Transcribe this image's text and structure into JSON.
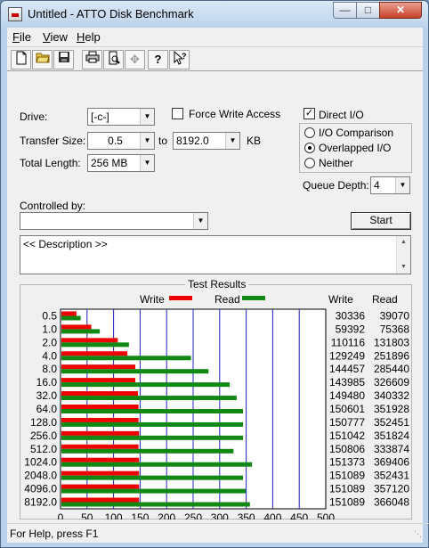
{
  "window": {
    "title": "Untitled - ATTO Disk Benchmark"
  },
  "menu": [
    {
      "key": "F",
      "rest": "ile"
    },
    {
      "key": "V",
      "rest": "iew"
    },
    {
      "key": "H",
      "rest": "elp"
    }
  ],
  "toolbar": {
    "icons": [
      "new-document-icon",
      "open-folder-icon",
      "save-icon",
      "print-icon",
      "print-preview-icon",
      "move-icon",
      "help-question-icon",
      "context-help-icon"
    ]
  },
  "form": {
    "drive_label": "Drive:",
    "drive_value": "[-c-]",
    "force_write_label": "Force Write Access",
    "force_write_checked": false,
    "direct_io_label": "Direct I/O",
    "direct_io_checked": true,
    "transfer_size_label": "Transfer Size:",
    "transfer_from": "0.5",
    "to_label": "to",
    "transfer_to": "8192.0",
    "kb_label": "KB",
    "total_length_label": "Total Length:",
    "total_length_value": "256 MB",
    "io_options": [
      {
        "label": "I/O Comparison",
        "selected": false
      },
      {
        "label": "Overlapped I/O",
        "selected": true
      },
      {
        "label": "Neither",
        "selected": false
      }
    ],
    "queue_depth_label": "Queue Depth:",
    "queue_depth_value": "4",
    "controlled_by_label": "Controlled by:",
    "controlled_by_value": "",
    "start_label": "Start",
    "description": "<< Description >>"
  },
  "results": {
    "title": "Test Results",
    "legend_write": "Write",
    "legend_read": "Read",
    "col_write": "Write",
    "col_read": "Read",
    "xlabel": "Transfer Rate - MB / Sec",
    "write_color": "#ee0000",
    "read_color": "#118811"
  },
  "chart_data": {
    "type": "bar",
    "orientation": "horizontal",
    "categories": [
      "0.5",
      "1.0",
      "2.0",
      "4.0",
      "8.0",
      "16.0",
      "32.0",
      "64.0",
      "128.0",
      "256.0",
      "512.0",
      "1024.0",
      "2048.0",
      "4096.0",
      "8192.0"
    ],
    "series": [
      {
        "name": "Write",
        "values": [
          30336,
          59392,
          110116,
          129249,
          144457,
          143985,
          149480,
          150601,
          150777,
          151042,
          150806,
          151373,
          151089,
          151089,
          151089
        ]
      },
      {
        "name": "Read",
        "values": [
          39070,
          75368,
          131803,
          251896,
          285440,
          326609,
          340332,
          351928,
          352451,
          351824,
          333874,
          369406,
          352431,
          357120,
          366048
        ]
      }
    ],
    "bar_values_mb_s": {
      "write": [
        30,
        58,
        108,
        126,
        141,
        141,
        146,
        147,
        147,
        148,
        147,
        148,
        148,
        148,
        148
      ],
      "read": [
        38,
        74,
        129,
        246,
        279,
        319,
        332,
        344,
        344,
        344,
        326,
        361,
        344,
        349,
        357
      ]
    },
    "xticks": [
      "0",
      "50",
      "100",
      "150",
      "200",
      "250",
      "300",
      "350",
      "400",
      "450",
      "500"
    ],
    "xlim": [
      0,
      500
    ],
    "xlabel": "Transfer Rate - MB / Sec",
    "grid": true,
    "legend_position": "top"
  },
  "status": {
    "text": "For Help, press F1"
  }
}
